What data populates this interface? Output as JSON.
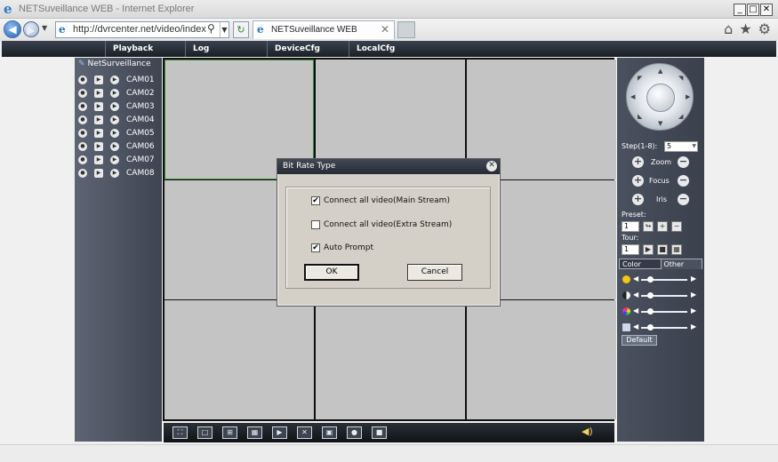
{
  "window": {
    "title": "NETSuveillance WEB - Internet Explorer",
    "logo": "e",
    "minimize": "_",
    "maximize": "□",
    "close": "✕"
  },
  "address_bar": {
    "url": "http://dvrcenter.net/video/index.js",
    "page_icon": "ie-page-icon",
    "tab_title": "NETSuveillance WEB",
    "tab_close": "✕"
  },
  "top_menu": {
    "items": [
      "Playback",
      "Log",
      "DeviceCfg",
      "LocalCfg"
    ]
  },
  "left_panel": {
    "header": "NetSurveillance",
    "cameras": [
      "CAM01",
      "CAM02",
      "CAM03",
      "CAM04",
      "CAM05",
      "CAM06",
      "CAM07",
      "CAM08"
    ]
  },
  "ptz": {
    "step_label": "Step(1-8):",
    "step_value": "5",
    "zoom_label": "Zoom",
    "focus_label": "Focus",
    "iris_label": "Iris",
    "preset_label": "Preset:",
    "preset_value": "1",
    "tour_label": "Tour:",
    "tour_value": "1"
  },
  "color_panel": {
    "tabs": [
      "Color",
      "Other"
    ],
    "sliders": [
      {
        "icon": "brightness-icon",
        "color": "#f5c518"
      },
      {
        "icon": "contrast-icon",
        "color": "#f2f2f2"
      },
      {
        "icon": "saturation-icon",
        "color": "#d94ad9"
      },
      {
        "icon": "hue-icon",
        "color": "#cfd8e6"
      }
    ],
    "default_label": "Default"
  },
  "dialog": {
    "title": "Bit Rate Type",
    "close": "✕",
    "options": [
      {
        "label": "Connect all video(Main Stream)",
        "checked": true
      },
      {
        "label": "Connect all video(Extra Stream)",
        "checked": false
      },
      {
        "label": "Auto Prompt",
        "checked": true
      }
    ],
    "ok_label": "OK",
    "cancel_label": "Cancel"
  },
  "colors": {
    "panel_dark": "#3e4451",
    "grid_cell": "#c4c4c4",
    "selected_cell": "#3a8a3a",
    "dialog_bg": "#d4d0c8"
  }
}
